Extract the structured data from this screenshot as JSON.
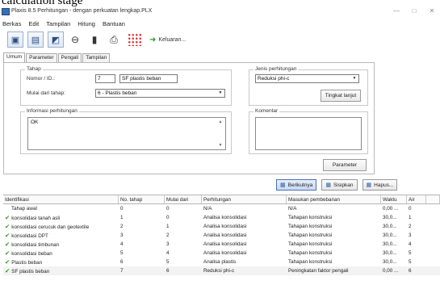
{
  "caption": "calculation stage",
  "window": {
    "title": "Plaxis 8.5 Perhitungan - dengan perkuatan lengkap.PLX",
    "minimize": "—",
    "maximize": "□",
    "close": "✕"
  },
  "menu": [
    "Berkas",
    "Edit",
    "Tampilan",
    "Hitung",
    "Bantuan"
  ],
  "toolbar": {
    "output_label": "Keluaran...",
    "icons": [
      "input-program-icon",
      "output-program-icon",
      "curves-program-icon",
      "link-icon",
      "save-icon",
      "print-icon",
      "select-points-icon",
      "output-arrow-icon"
    ]
  },
  "tabs": [
    "Umum",
    "Parameter",
    "Pengali",
    "Tampilan"
  ],
  "phase": {
    "group_label": "Tahap",
    "name_label": "Nomor / ID.:",
    "number": "7",
    "id_value": "SF plastis beban",
    "start_from_label": "Mulai dari tahap:",
    "start_from_value": "6 - Plastis beban"
  },
  "calc_type": {
    "group_label": "Jenis perhitungan",
    "value": "Reduksi phi-c",
    "advanced_button": "Tingkat lanjut"
  },
  "info": {
    "group_label": "Informasi perhitungan",
    "text": "OK"
  },
  "comment": {
    "group_label": "Komentar",
    "text": ""
  },
  "parameters_button": "Parameter",
  "actions": {
    "next": "Berikutnya",
    "insert": "Sisipkan",
    "delete": "Hapus..."
  },
  "table": {
    "headers": [
      "Identifikasi",
      "No. tahap",
      "Mulai dari",
      "Perhitungan",
      "Masukan pembebanan",
      "Waktu",
      "Air",
      ""
    ],
    "rows": [
      {
        "checked": false,
        "id": "Tahap awal",
        "no": "0",
        "from": "0",
        "calc": "N/A",
        "load": "N/A",
        "time": "0,00 ...",
        "water": "0",
        "extra": ""
      },
      {
        "checked": true,
        "id": "konsolidasi tanah asli",
        "no": "1",
        "from": "0",
        "calc": "Analisa konsolidasi",
        "load": "Tahapan konstruksi",
        "time": "30,0...",
        "water": "1",
        "extra": ""
      },
      {
        "checked": true,
        "id": "konsolidasi cerucuk dan geotextile",
        "no": "2",
        "from": "1",
        "calc": "Analisa konsolidasi",
        "load": "Tahapan konstruksi",
        "time": "30,0...",
        "water": "2",
        "extra": ""
      },
      {
        "checked": true,
        "id": "konsolidasi DPT",
        "no": "3",
        "from": "2",
        "calc": "Analisa konsolidasi",
        "load": "Tahapan konstruksi",
        "time": "30,0...",
        "water": "3",
        "extra": ""
      },
      {
        "checked": true,
        "id": "konsolidasi timbunan",
        "no": "4",
        "from": "3",
        "calc": "Analisa konsolidasi",
        "load": "Tahapan konstruksi",
        "time": "30,0...",
        "water": "4",
        "extra": ""
      },
      {
        "checked": true,
        "id": "konsolidasi beban",
        "no": "5",
        "from": "4",
        "calc": "Analisa konsolidasi",
        "load": "Tahapan konstruksi",
        "time": "30,0...",
        "water": "5",
        "extra": ""
      },
      {
        "checked": true,
        "id": "Plastis beban",
        "no": "6",
        "from": "5",
        "calc": "Analisa plastis",
        "load": "Tahapan konstruksi",
        "time": "30,0...",
        "water": "5",
        "extra": ""
      },
      {
        "checked": true,
        "id": "SF plastis beban",
        "no": "7",
        "from": "6",
        "calc": "Reduksi phi-c",
        "load": "Peningkatan faktor pengali",
        "time": "0,00 ...",
        "water": "6",
        "extra": ""
      }
    ]
  },
  "colors": {
    "check": "#2f9a2f",
    "accent": "#2e5fa8"
  }
}
